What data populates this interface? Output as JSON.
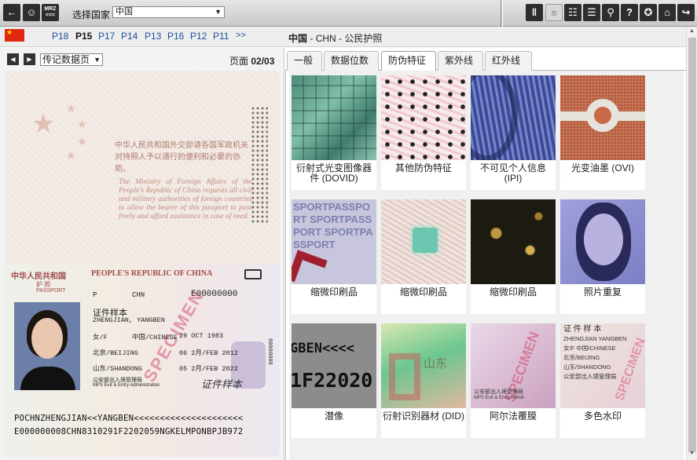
{
  "toolbar": {
    "country_label": "选择国家",
    "country_value": "中国",
    "mrz_icon_text": "MRZ\n<<<",
    "right_icons": [
      "uv-torch-icon",
      "blank-page-icon",
      "pages-icon",
      "list-icon",
      "magnifier-icon",
      "help-icon",
      "badge-icon",
      "home-icon",
      "exit-icon"
    ]
  },
  "pagebar": {
    "pages": [
      "P18",
      "P15",
      "P17",
      "P14",
      "P13",
      "P16",
      "P12",
      "P11",
      ">>"
    ],
    "active_page": "P15",
    "doc_country": "中国",
    "doc_code": "CHN",
    "doc_type": "公民护照"
  },
  "left": {
    "page_type": "传记数据页",
    "page_label": "页面",
    "page_num": "02/03"
  },
  "passport": {
    "cn_text": "中华人民共和国外交部请各国军政机关对持照人予以通行的便利和必要的协助。",
    "en_text": "The Ministry of Foreign Affairs of the People's Republic of China requests all civil and military authorities of foreign countries to allow the bearer of this passport to pass freely and afford assistance in case of need.",
    "header_cn": "中华人民共和国",
    "header_en": "PEOPLE'S REPUBLIC OF CHINA",
    "sub_cn": "护 照",
    "sub_en": "PASSPORT",
    "type": "P",
    "country_code": "CHN",
    "passport_no": "E00000000",
    "name_cn": "证件样本",
    "name_en": "ZHENGJIAN, YANGBEN",
    "sex": "女/F",
    "nationality": "中国/CHINESE",
    "dob": "29 OCT 1983",
    "pob": "北京/BEIJING",
    "doi": "06 2月/FEB 2012",
    "poi": "山东/SHANDONG",
    "doe": "05 2月/FEB 2022",
    "authority": "公安部出入境管理局",
    "authority_en": "MPS Exit & Entry Administration",
    "specimen": "SPECIMEN",
    "signature": "证件样本",
    "vertical_no": "00000000",
    "mrz1": "POCHNZHENGJIAN<<YANGBEN<<<<<<<<<<<<<<<<<<<<<",
    "mrz2": "E000000008CHN8310291F2202059NGKELMPONBPJB972"
  },
  "tabs": [
    "一般",
    "数据位数",
    "防伪特征",
    "紫外线",
    "红外线"
  ],
  "active_tab": "防伪特征",
  "features": [
    {
      "label": "衍射式光变图像器件 (DOVID)",
      "thumb": "dovid"
    },
    {
      "label": "其他防伪特征",
      "thumb": "dots"
    },
    {
      "label": "不可见个人信息 (IPI)",
      "thumb": "ipi"
    },
    {
      "label": "光变油墨 (OVI)",
      "thumb": "ovi"
    },
    {
      "label": "缩微印刷品",
      "thumb": "micro1"
    },
    {
      "label": "缩微印刷品",
      "thumb": "micro2"
    },
    {
      "label": "缩微印刷品",
      "thumb": "micro3"
    },
    {
      "label": "照片重复",
      "thumb": "ghost"
    },
    {
      "label": "潜像",
      "thumb": "latent"
    },
    {
      "label": "衍射识别器材 (DID)",
      "thumb": "did"
    },
    {
      "label": "阿尔法覆膜",
      "thumb": "alpha"
    },
    {
      "label": "多色水印",
      "thumb": "watermark"
    }
  ],
  "thumb_text": {
    "micro_pass": "SPORTPASSPORT",
    "latent_line1": "GBEN<<<<",
    "latent_line2": "1F22020",
    "did_text": "山东",
    "alpha_lines": [
      "公安部出入境管理局",
      "MPS Exit & Entry Admin"
    ],
    "wm_lines": [
      "证 件 样 本",
      "ZHENGJIAN YANGBEN",
      "女/F  中国/CHINESE",
      "北京/BEIJING",
      "山东/SHANDONG",
      "公安部出入境管理局"
    ]
  }
}
